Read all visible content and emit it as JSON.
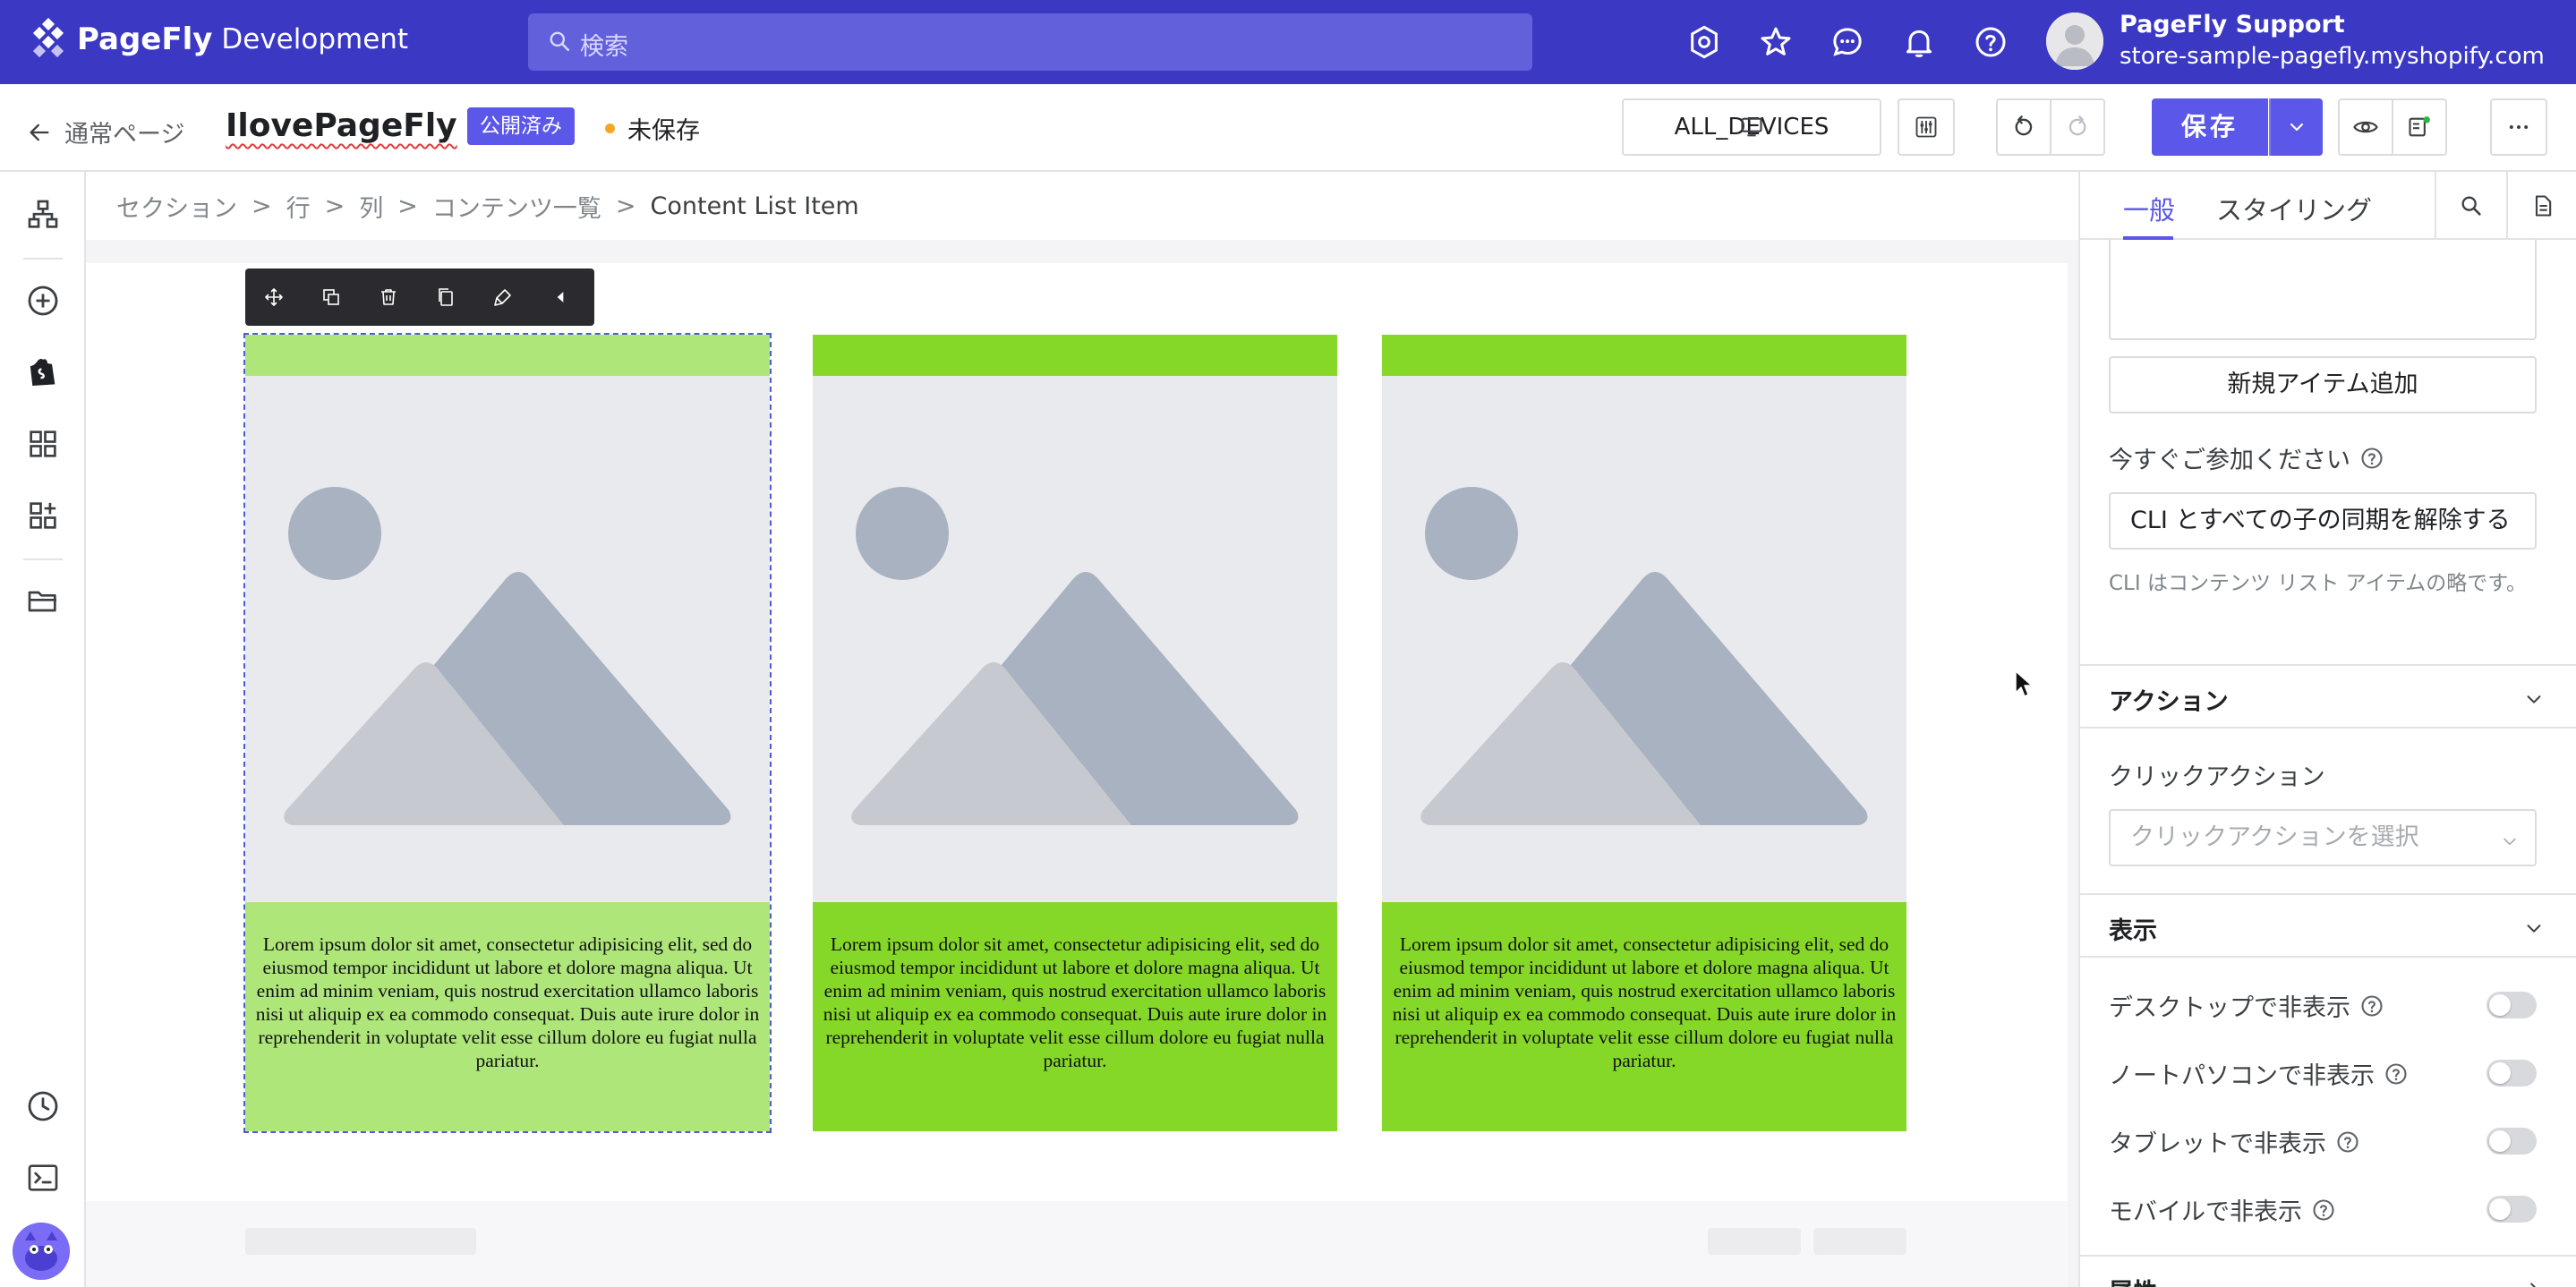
{
  "app": {
    "brand": "PageFly",
    "brand_sub": "Development",
    "search_placeholder": "検索",
    "profile_name": "PageFly Support",
    "profile_store": "store-sample-pagefly.myshopify.com"
  },
  "editor_bar": {
    "back_label": "通常ページ",
    "page_title": "IlovePageFly",
    "status_badge": "公開済み",
    "unsaved_label": "未保存",
    "devices_label": "ALL_DEVICES",
    "save_label": "保存"
  },
  "breadcrumb": {
    "items": [
      "セクション",
      "行",
      "列",
      "コンテンツ一覧",
      "Content List Item"
    ],
    "separator": ">"
  },
  "cards": [
    {
      "text": "Lorem ipsum dolor sit amet, consectetur adipisicing elit, sed do eiusmod tempor incididunt ut labore et dolore magna aliqua. Ut enim ad minim veniam, quis nostrud exercitation ullamco laboris nisi ut aliquip ex ea commodo consequat. Duis aute irure dolor in reprehenderit in voluptate velit esse cillum dolore eu fugiat nulla pariatur.",
      "selected": true
    },
    {
      "text": "Lorem ipsum dolor sit amet, consectetur adipisicing elit, sed do eiusmod tempor incididunt ut labore et dolore magna aliqua. Ut enim ad minim veniam, quis nostrud exercitation ullamco laboris nisi ut aliquip ex ea commodo consequat. Duis aute irure dolor in reprehenderit in voluptate velit esse cillum dolore eu fugiat nulla pariatur.",
      "selected": false
    },
    {
      "text": "Lorem ipsum dolor sit amet, consectetur adipisicing elit, sed do eiusmod tempor incididunt ut labore et dolore magna aliqua. Ut enim ad minim veniam, quis nostrud exercitation ullamco laboris nisi ut aliquip ex ea commodo consequat. Duis aute irure dolor in reprehenderit in voluptate velit esse cillum dolore eu fugiat nulla pariatur.",
      "selected": false
    }
  ],
  "panel": {
    "tab_general": "一般",
    "tab_styling": "スタイリング",
    "add_item_label": "新規アイテム追加",
    "join_label": "今すぐご参加ください",
    "join_value": "CLI とすべての子の同期を解除する",
    "join_help": "CLI はコンテンツ リスト アイテムの略です。",
    "action_section": "アクション",
    "click_action_label": "クリックアクション",
    "click_action_placeholder": "クリックアクションを選択",
    "display_section": "表示",
    "toggles": [
      {
        "label": "デスクトップで非表示",
        "on": false
      },
      {
        "label": "ノートパソコンで非表示",
        "on": false
      },
      {
        "label": "タブレットで非表示",
        "on": false
      },
      {
        "label": "モバイルで非表示",
        "on": false
      }
    ],
    "attributes_section": "属性"
  },
  "colors": {
    "topbar": "#3b38c4",
    "accent": "#5b57e8",
    "card_green": "#86d828",
    "card_selected": "#aee67a"
  },
  "icons": {
    "topbar": [
      "settings-icon",
      "star-icon",
      "chat-icon",
      "bell-icon",
      "help-icon"
    ],
    "rail": [
      "layers-icon",
      "add-icon",
      "shopify-icon",
      "grid-icon",
      "widgets-icon",
      "folder-icon",
      "history-icon",
      "terminal-icon"
    ],
    "toolbar": [
      "move-icon",
      "duplicate-icon",
      "delete-icon",
      "copy-icon",
      "paint-icon",
      "collapse-icon"
    ]
  }
}
